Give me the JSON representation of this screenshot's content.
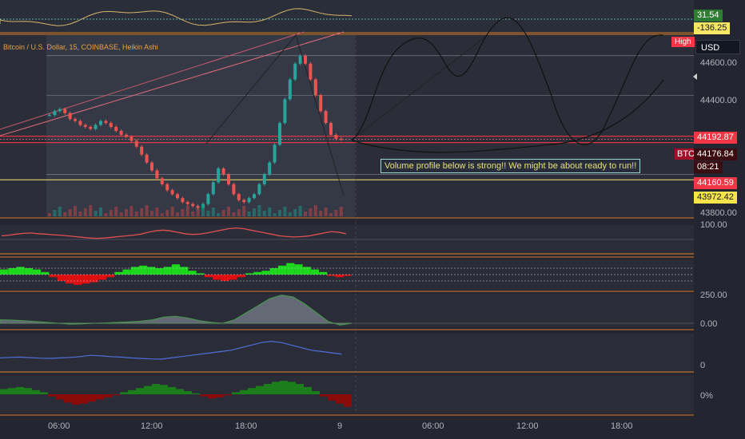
{
  "header": {
    "title": "Bitcoin / U.S. Dollar, 15, COINBASE, Heikin Ashi"
  },
  "currency_button": "USD",
  "high_tag": "High",
  "annotation": "Volume profile below is strong!! We might be about ready to run!!",
  "ticker_tag": "BTCUSD",
  "price_labels": [
    {
      "text": "31.54",
      "bg": "#2e7d32",
      "fg": "#ffffff"
    },
    {
      "text": "-136.25",
      "bg": "#f5e663",
      "fg": "#131722"
    },
    {
      "text": "44192.87",
      "bg": "#f23645",
      "fg": "#ffffff"
    },
    {
      "text": "44176.84",
      "bg": "#3b0d12",
      "fg": "#ffffff"
    },
    {
      "text": "08:21",
      "bg": "#3b0d12",
      "fg": "#ffffff"
    },
    {
      "text": "44160.59",
      "bg": "#f23645",
      "fg": "#ffffff"
    },
    {
      "text": "43972.42",
      "bg": "#f7e44a",
      "fg": "#131722"
    }
  ],
  "axis_labels": [
    "44600.00",
    "44400.00",
    "43800.00",
    "100.00",
    "250.00",
    "0.00",
    "0",
    "0%"
  ],
  "time_labels": [
    "06:00",
    "12:00",
    "18:00",
    "9",
    "06:00",
    "12:00",
    "18:00"
  ],
  "colors": {
    "bull": "#26a69a",
    "bear": "#ef5350",
    "brightGreen": "#1bd81b",
    "brightRed": "#e01010",
    "darkGreen": "#1b7e1b",
    "darkRed": "#8b0a0a",
    "orangeLine": "#e8893a",
    "yellowLine": "#f5e66b",
    "redLine": "#f23645",
    "blueLine": "#4f6fd8",
    "pinkLine": "#e05a8a",
    "panelSep": "#d9822b"
  },
  "chart_data": {
    "type": "candlestick",
    "symbol": "BTCUSD",
    "ylim": [
      43800,
      44680
    ],
    "levels": {
      "resistance_red": 44192.87,
      "current": 44176.84,
      "support_red": 44160.59,
      "support_yellow": 43972.42
    },
    "candles_close": [
      44300,
      44320,
      44330,
      44310,
      44280,
      44270,
      44250,
      44240,
      44230,
      44250,
      44270,
      44260,
      44240,
      44220,
      44200,
      44190,
      44170,
      44140,
      44100,
      44060,
      44020,
      43980,
      43950,
      43920,
      43900,
      43880,
      43860,
      43850,
      43840,
      43830,
      43850,
      43900,
      43960,
      44030,
      44000,
      43950,
      43900,
      43870,
      43860,
      43880,
      43900,
      43950,
      44000,
      44060,
      44150,
      44260,
      44380,
      44480,
      44560,
      44600,
      44560,
      44480,
      44400,
      44320,
      44260,
      44200,
      44180,
      44176.84
    ],
    "oscillator_1": [
      50,
      52,
      55,
      57,
      58,
      56,
      55,
      53,
      52,
      50,
      48,
      46,
      44,
      43,
      44,
      46,
      48,
      50,
      52,
      55,
      60,
      64,
      66,
      64,
      60,
      56,
      54,
      55,
      58,
      62,
      66,
      70,
      72,
      70,
      66,
      62,
      58,
      54,
      50,
      48,
      47,
      48,
      50,
      54,
      58,
      62,
      60,
      56
    ],
    "histogram": [
      4,
      5,
      6,
      5,
      4,
      2,
      -2,
      -5,
      -7,
      -8,
      -7,
      -6,
      -4,
      -2,
      2,
      4,
      6,
      7,
      6,
      5,
      6,
      8,
      6,
      3,
      1,
      -2,
      -4,
      -5,
      -4,
      -2,
      1,
      2,
      3,
      5,
      7,
      9,
      8,
      6,
      4,
      2,
      -1,
      -2,
      -1
    ],
    "momentum": [
      20,
      18,
      15,
      10,
      5,
      0,
      -5,
      -3,
      0,
      2,
      5,
      8,
      12,
      20,
      35,
      40,
      30,
      15,
      5,
      0,
      20,
      60,
      100,
      140,
      160,
      150,
      110,
      60,
      10,
      -10
    ],
    "oscillator_2": [
      30,
      32,
      33,
      31,
      29,
      28,
      30,
      32,
      35,
      40,
      38,
      35,
      33,
      30,
      28,
      26,
      25,
      30,
      35,
      40,
      45,
      50,
      55,
      60,
      70,
      80,
      90,
      95,
      90,
      80,
      70,
      60,
      55,
      50,
      45
    ],
    "histogram_2": [
      5,
      6,
      7,
      6,
      4,
      2,
      -2,
      -5,
      -8,
      -10,
      -9,
      -7,
      -5,
      -3,
      -1,
      2,
      4,
      6,
      8,
      10,
      9,
      7,
      5,
      3,
      1,
      -2,
      -4,
      -3,
      -1,
      2,
      4,
      6,
      8,
      10,
      12,
      13,
      12,
      10,
      7,
      3,
      -2,
      -6,
      -9,
      -12
    ]
  }
}
